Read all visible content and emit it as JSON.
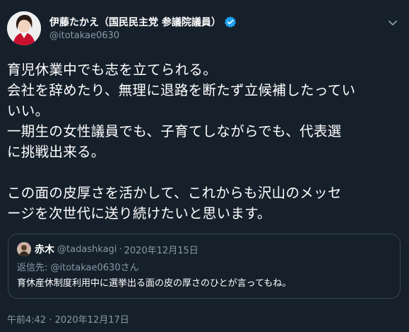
{
  "author": {
    "display_name": "伊藤たかえ（国民民主党 参議院議員）",
    "handle": "@itotakae0630",
    "avatar_icon": "profile-photo-woman",
    "verified_icon": "verified-badge-icon"
  },
  "tweet": {
    "text": "育児休業中でも志を立てられる。\n会社を辞めたり、無理に退路を断たず立候補したってい\nいい。\n一期生の女性議員でも、子育てしながらでも、代表選\nに挑戦出来る。\n\nこの面の皮厚さを活かして、これからも沢山のメッセ\nージを次世代に送り続けたいと思います。",
    "timestamp": "午前4:42 · 2020年12月17日"
  },
  "quoted_tweet": {
    "name": "赤木",
    "handle": "@tadashkagi",
    "separator": "·",
    "date": "2020年12月15日",
    "reply_to": "返信先: @itotakae0630さん",
    "text": "育休産休制度利用中に選挙出る面の皮の厚さのひとが言ってもね。"
  },
  "colors": {
    "background": "#15202b",
    "text_primary": "#ffffff",
    "text_secondary": "#8899a6",
    "border": "#38444d",
    "verified_blue": "#1da1f2"
  }
}
